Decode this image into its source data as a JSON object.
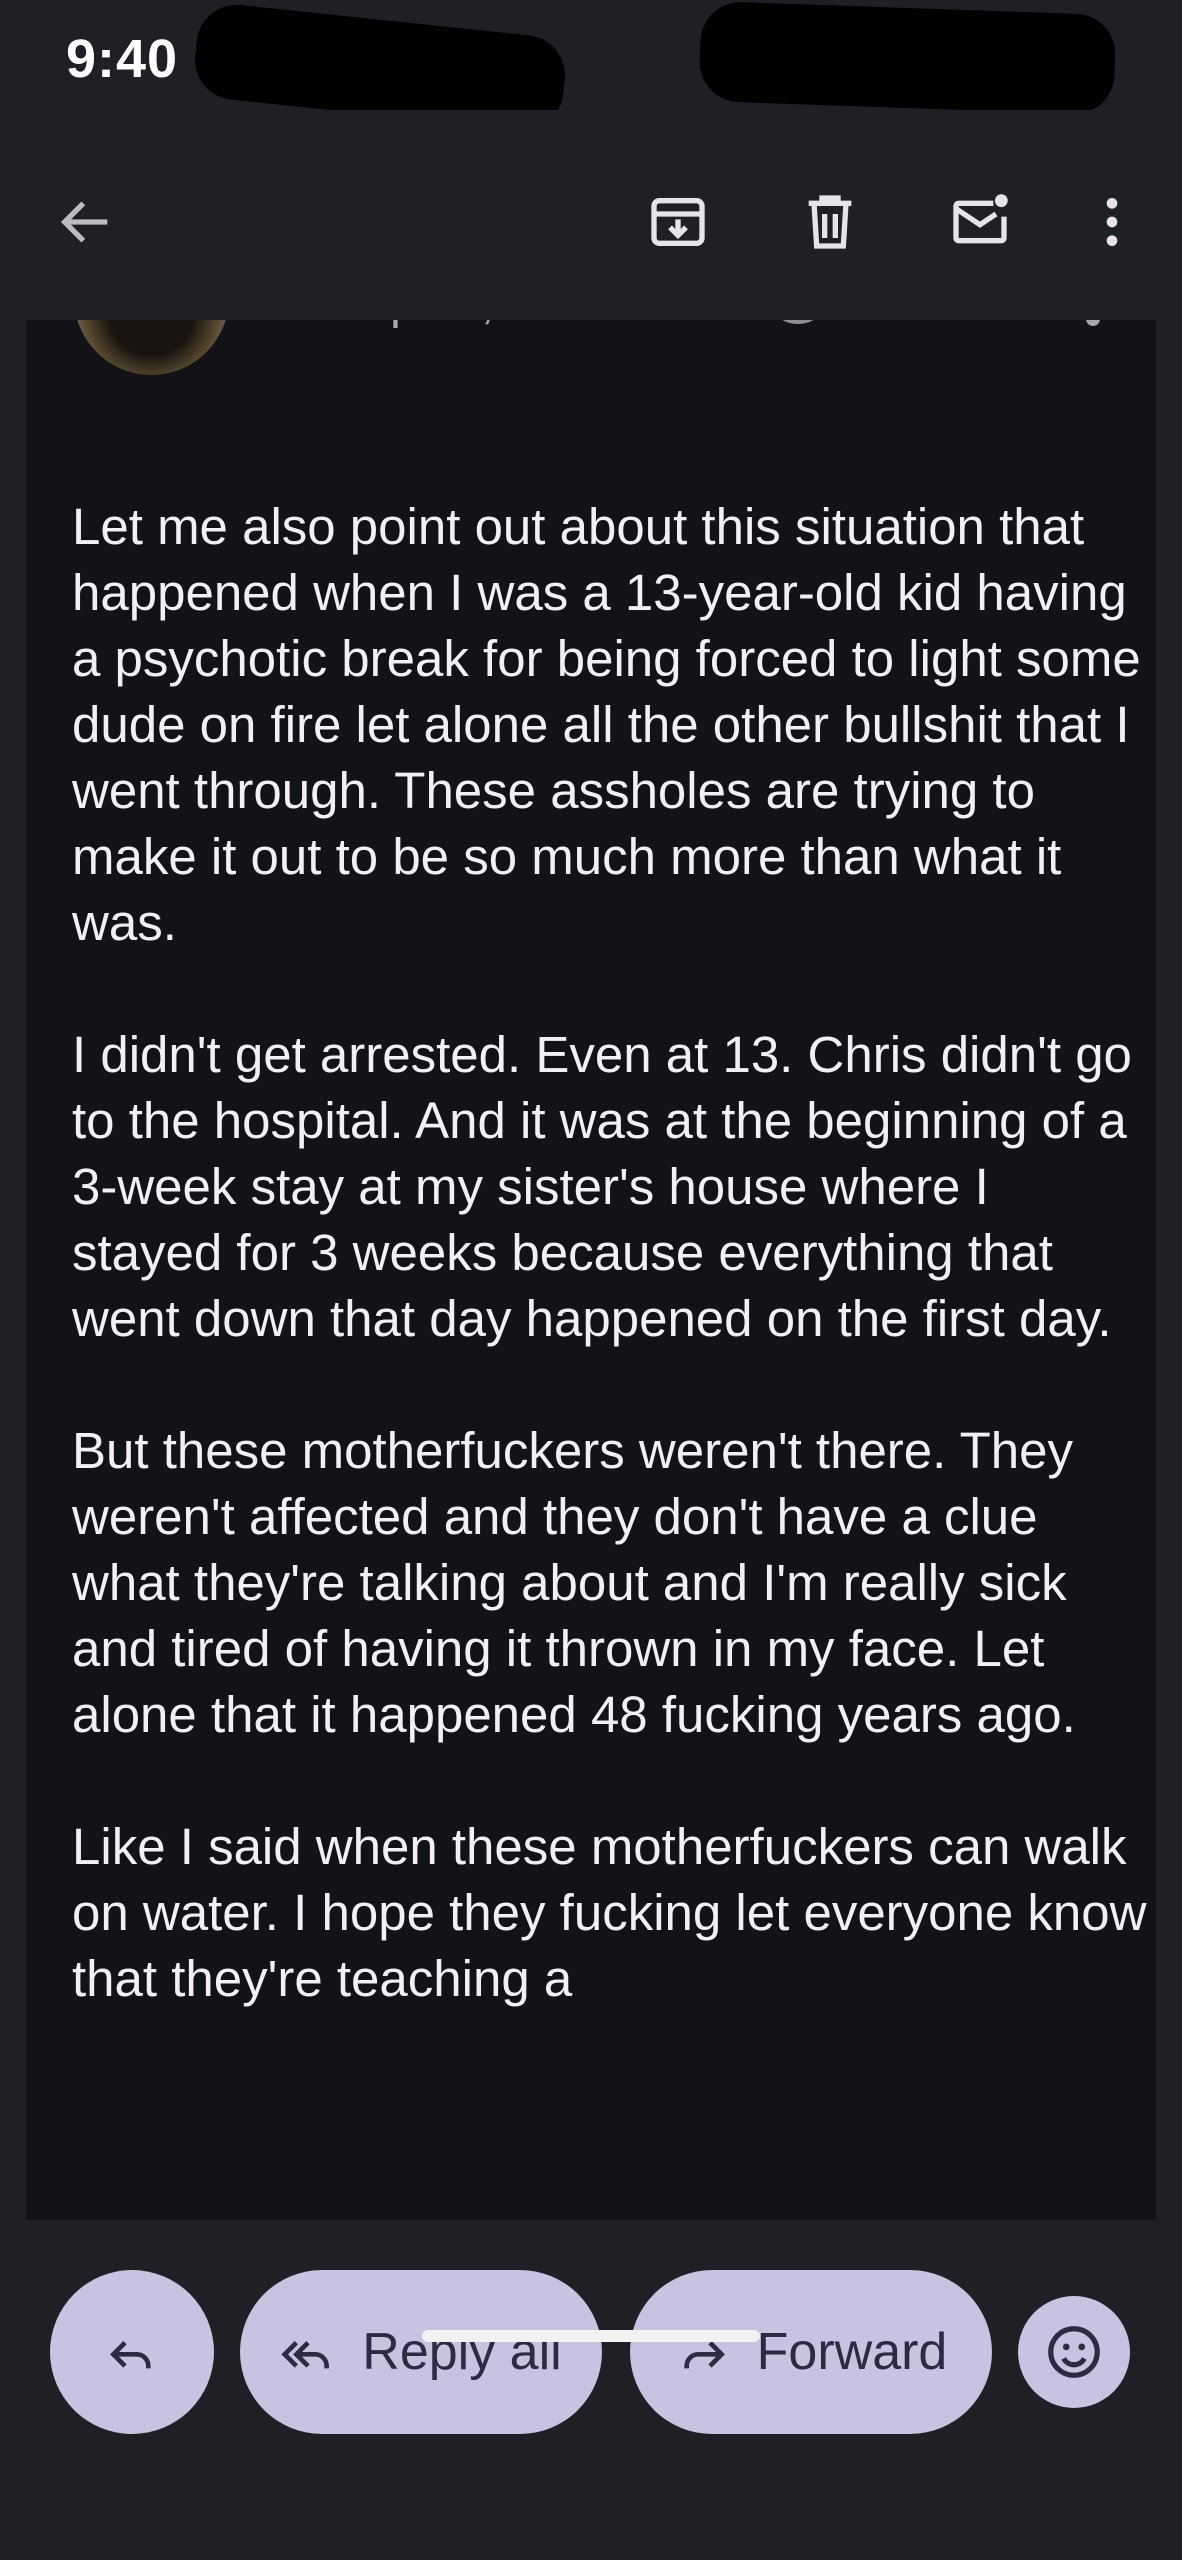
{
  "status_bar": {
    "time": "9:40"
  },
  "toolbar": {
    "back_icon": "arrow-back-icon",
    "archive_icon": "archive-icon",
    "delete_icon": "trash-icon",
    "mark_unread_icon": "mark-unread-icon",
    "more_icon": "more-vert-icon"
  },
  "email": {
    "recipients": "to Sophia, Neil...",
    "paragraphs": [
      "Let me also point out about this situation that happened when I was a 13-year-old kid having a psychotic break for being forced to light some dude on fire let alone all the other bullshit that I went through. These assholes are trying to make it out to be so much more than what it was.",
      "I didn't get arrested. Even at 13. Chris didn't go to the hospital. And it was at the beginning of a 3-week stay at my sister's house where I stayed for 3 weeks because everything that went down that day happened on the first day.",
      "But these motherfuckers weren't there. They weren't affected and they don't have a clue what they're talking about and I'm really sick and tired of having it thrown in my face. Let alone that it happened 48 fucking years ago.",
      "Like I said when these motherfuckers can walk on water. I hope they fucking let everyone know that they're teaching a"
    ]
  },
  "actions": {
    "reply_icon": "reply-icon",
    "reply_all_label": "Reply all",
    "reply_all_icon": "reply-all-icon",
    "forward_label": "Forward",
    "forward_icon": "forward-icon",
    "emoji_icon": "emoji-reaction-icon"
  },
  "colors": {
    "background": "#1f1f26",
    "message_card": "#131217",
    "action_pill": "#c9c2e0",
    "action_text": "#2f2a43"
  }
}
